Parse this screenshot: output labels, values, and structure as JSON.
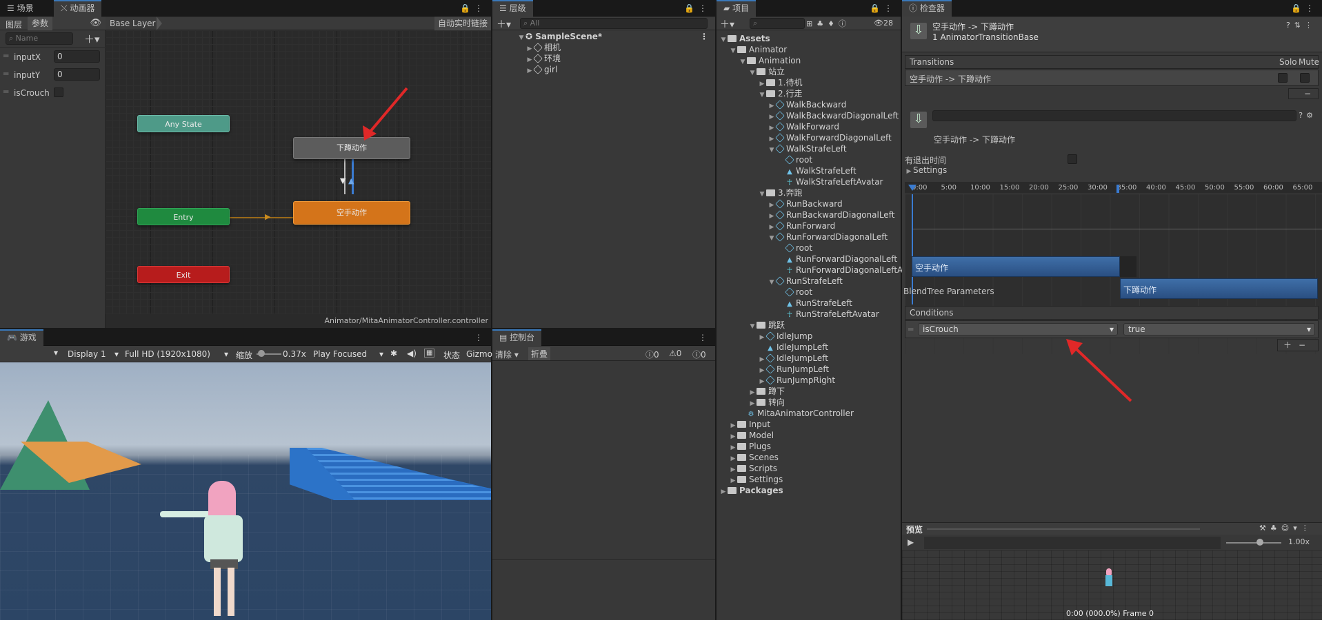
{
  "scene_panel": {
    "tab_scene": "场景",
    "tab_animator": "动画器",
    "tab_layers": "图层",
    "tab_params": "参数",
    "search_placeholder": "Name",
    "params": [
      {
        "name": "inputX",
        "value": "0"
      },
      {
        "name": "inputY",
        "value": "0"
      },
      {
        "name": "isCrouch",
        "value": ""
      }
    ],
    "breadcrumb": "Base Layer",
    "autolink": "自动实时链接",
    "footer_path": "Animator/MitaAnimatorController.controller",
    "nodes": {
      "any": "Any State",
      "entry": "Entry",
      "exit": "Exit",
      "crouch": "下蹲动作",
      "idle": "空手动作"
    }
  },
  "game_panel": {
    "tab": "游戏",
    "display": "Display 1",
    "resolution": "Full HD (1920x1080)",
    "zoom_label": "缩放",
    "zoom_value": "0.37x",
    "play_mode": "Play Focused",
    "stats": "状态",
    "gizmos": "Gizmo"
  },
  "hierarchy": {
    "tab": "层级",
    "search_placeholder": "All",
    "scene": "SampleScene*",
    "children": [
      "相机",
      "环境",
      "girl"
    ]
  },
  "console": {
    "tab": "控制台",
    "clear": "清除",
    "collapse": "折叠",
    "counts": [
      "0",
      "0",
      "0"
    ]
  },
  "project": {
    "tab": "项目",
    "badge": "28",
    "tree": [
      {
        "d": 0,
        "t": "folder",
        "e": "v",
        "label": "Assets",
        "bold": true
      },
      {
        "d": 1,
        "t": "folder",
        "e": "v",
        "label": "Animator"
      },
      {
        "d": 2,
        "t": "folder",
        "e": "v",
        "label": "Animation"
      },
      {
        "d": 3,
        "t": "folder",
        "e": "v",
        "label": "站立"
      },
      {
        "d": 4,
        "t": "folder",
        "e": ">",
        "label": "1.待机"
      },
      {
        "d": 4,
        "t": "folder",
        "e": "v",
        "label": "2.行走"
      },
      {
        "d": 5,
        "t": "cube",
        "e": ">",
        "label": "WalkBackward"
      },
      {
        "d": 5,
        "t": "cube",
        "e": ">",
        "label": "WalkBackwardDiagonalLeft"
      },
      {
        "d": 5,
        "t": "cube",
        "e": ">",
        "label": "WalkForward"
      },
      {
        "d": 5,
        "t": "cube",
        "e": ">",
        "label": "WalkForwardDiagonalLeft"
      },
      {
        "d": 5,
        "t": "cube",
        "e": "v",
        "label": "WalkStrafeLeft"
      },
      {
        "d": 6,
        "t": "cube",
        "e": "",
        "label": "root"
      },
      {
        "d": 6,
        "t": "anim",
        "e": "",
        "label": "WalkStrafeLeft"
      },
      {
        "d": 6,
        "t": "hum",
        "e": "",
        "label": "WalkStrafeLeftAvatar"
      },
      {
        "d": 4,
        "t": "folder",
        "e": "v",
        "label": "3.奔跑"
      },
      {
        "d": 5,
        "t": "cube",
        "e": ">",
        "label": "RunBackward"
      },
      {
        "d": 5,
        "t": "cube",
        "e": ">",
        "label": "RunBackwardDiagonalLeft"
      },
      {
        "d": 5,
        "t": "cube",
        "e": ">",
        "label": "RunForward"
      },
      {
        "d": 5,
        "t": "cube",
        "e": "v",
        "label": "RunForwardDiagonalLeft"
      },
      {
        "d": 6,
        "t": "cube",
        "e": "",
        "label": "root"
      },
      {
        "d": 6,
        "t": "anim",
        "e": "",
        "label": "RunForwardDiagonalLeft"
      },
      {
        "d": 6,
        "t": "hum",
        "e": "",
        "label": "RunForwardDiagonalLeftA"
      },
      {
        "d": 5,
        "t": "cube",
        "e": "v",
        "label": "RunStrafeLeft"
      },
      {
        "d": 6,
        "t": "cube",
        "e": "",
        "label": "root"
      },
      {
        "d": 6,
        "t": "anim",
        "e": "",
        "label": "RunStrafeLeft"
      },
      {
        "d": 6,
        "t": "hum",
        "e": "",
        "label": "RunStrafeLeftAvatar"
      },
      {
        "d": 3,
        "t": "folder",
        "e": "v",
        "label": "跳跃"
      },
      {
        "d": 4,
        "t": "cube",
        "e": ">",
        "label": "IdleJump"
      },
      {
        "d": 4,
        "t": "anim",
        "e": "",
        "label": "IdleJumpLeft"
      },
      {
        "d": 4,
        "t": "cube",
        "e": ">",
        "label": "IdleJumpLeft"
      },
      {
        "d": 4,
        "t": "cube",
        "e": ">",
        "label": "RunJumpLeft"
      },
      {
        "d": 4,
        "t": "cube",
        "e": ">",
        "label": "RunJumpRight"
      },
      {
        "d": 3,
        "t": "folder",
        "e": ">",
        "label": "蹲下"
      },
      {
        "d": 3,
        "t": "folder",
        "e": ">",
        "label": "转向"
      },
      {
        "d": 2,
        "t": "ctrl",
        "e": "",
        "label": "MitaAnimatorController"
      },
      {
        "d": 1,
        "t": "folder",
        "e": ">",
        "label": "Input"
      },
      {
        "d": 1,
        "t": "folder",
        "e": ">",
        "label": "Model"
      },
      {
        "d": 1,
        "t": "folder",
        "e": ">",
        "label": "Plugs"
      },
      {
        "d": 1,
        "t": "folder",
        "e": ">",
        "label": "Scenes"
      },
      {
        "d": 1,
        "t": "folder",
        "e": ">",
        "label": "Scripts"
      },
      {
        "d": 1,
        "t": "folder",
        "e": ">",
        "label": "Settings"
      },
      {
        "d": 0,
        "t": "folder",
        "e": ">",
        "label": "Packages",
        "bold": true
      }
    ]
  },
  "inspector": {
    "tab": "检查器",
    "title": "空手动作 -> 下蹲动作",
    "subtitle": "1 AnimatorTransitionBase",
    "transitions_label": "Transitions",
    "solo": "Solo",
    "mute": "Mute",
    "transition_item": "空手动作 -> 下蹲动作",
    "transition_name": "空手动作 -> 下蹲动作",
    "has_exit_time": "有退出时间",
    "settings": "Settings",
    "ticks": [
      "0:00",
      "5:00",
      "10:00",
      "15:00",
      "20:00",
      "25:00",
      "30:00",
      "35:00",
      "40:00",
      "45:00",
      "50:00",
      "55:00",
      "60:00",
      "65:00"
    ],
    "clip_from": "空手动作",
    "clip_to": "下蹲动作",
    "blend_params": "BlendTree Parameters",
    "conditions_label": "Conditions",
    "condition_param": "isCrouch",
    "condition_value": "true",
    "preview_label": "预览",
    "preview_speed": "1.00x",
    "preview_time": "0:00 (000.0%) Frame 0"
  }
}
